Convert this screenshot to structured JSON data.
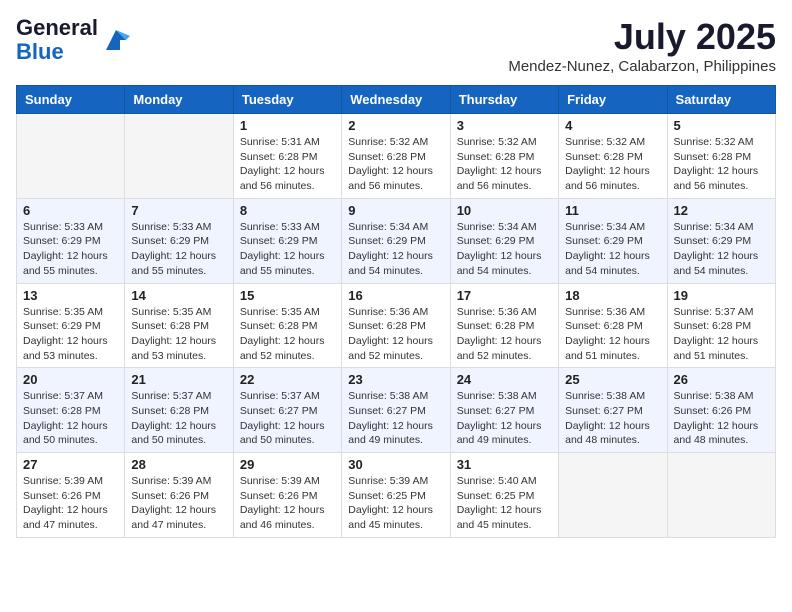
{
  "header": {
    "logo_general": "General",
    "logo_blue": "Blue",
    "month_title": "July 2025",
    "location": "Mendez-Nunez, Calabarzon, Philippines"
  },
  "days_of_week": [
    "Sunday",
    "Monday",
    "Tuesday",
    "Wednesday",
    "Thursday",
    "Friday",
    "Saturday"
  ],
  "weeks": [
    [
      {
        "day": "",
        "info": ""
      },
      {
        "day": "",
        "info": ""
      },
      {
        "day": "1",
        "info": "Sunrise: 5:31 AM\nSunset: 6:28 PM\nDaylight: 12 hours and 56 minutes."
      },
      {
        "day": "2",
        "info": "Sunrise: 5:32 AM\nSunset: 6:28 PM\nDaylight: 12 hours and 56 minutes."
      },
      {
        "day": "3",
        "info": "Sunrise: 5:32 AM\nSunset: 6:28 PM\nDaylight: 12 hours and 56 minutes."
      },
      {
        "day": "4",
        "info": "Sunrise: 5:32 AM\nSunset: 6:28 PM\nDaylight: 12 hours and 56 minutes."
      },
      {
        "day": "5",
        "info": "Sunrise: 5:32 AM\nSunset: 6:28 PM\nDaylight: 12 hours and 56 minutes."
      }
    ],
    [
      {
        "day": "6",
        "info": "Sunrise: 5:33 AM\nSunset: 6:29 PM\nDaylight: 12 hours and 55 minutes."
      },
      {
        "day": "7",
        "info": "Sunrise: 5:33 AM\nSunset: 6:29 PM\nDaylight: 12 hours and 55 minutes."
      },
      {
        "day": "8",
        "info": "Sunrise: 5:33 AM\nSunset: 6:29 PM\nDaylight: 12 hours and 55 minutes."
      },
      {
        "day": "9",
        "info": "Sunrise: 5:34 AM\nSunset: 6:29 PM\nDaylight: 12 hours and 54 minutes."
      },
      {
        "day": "10",
        "info": "Sunrise: 5:34 AM\nSunset: 6:29 PM\nDaylight: 12 hours and 54 minutes."
      },
      {
        "day": "11",
        "info": "Sunrise: 5:34 AM\nSunset: 6:29 PM\nDaylight: 12 hours and 54 minutes."
      },
      {
        "day": "12",
        "info": "Sunrise: 5:34 AM\nSunset: 6:29 PM\nDaylight: 12 hours and 54 minutes."
      }
    ],
    [
      {
        "day": "13",
        "info": "Sunrise: 5:35 AM\nSunset: 6:29 PM\nDaylight: 12 hours and 53 minutes."
      },
      {
        "day": "14",
        "info": "Sunrise: 5:35 AM\nSunset: 6:28 PM\nDaylight: 12 hours and 53 minutes."
      },
      {
        "day": "15",
        "info": "Sunrise: 5:35 AM\nSunset: 6:28 PM\nDaylight: 12 hours and 52 minutes."
      },
      {
        "day": "16",
        "info": "Sunrise: 5:36 AM\nSunset: 6:28 PM\nDaylight: 12 hours and 52 minutes."
      },
      {
        "day": "17",
        "info": "Sunrise: 5:36 AM\nSunset: 6:28 PM\nDaylight: 12 hours and 52 minutes."
      },
      {
        "day": "18",
        "info": "Sunrise: 5:36 AM\nSunset: 6:28 PM\nDaylight: 12 hours and 51 minutes."
      },
      {
        "day": "19",
        "info": "Sunrise: 5:37 AM\nSunset: 6:28 PM\nDaylight: 12 hours and 51 minutes."
      }
    ],
    [
      {
        "day": "20",
        "info": "Sunrise: 5:37 AM\nSunset: 6:28 PM\nDaylight: 12 hours and 50 minutes."
      },
      {
        "day": "21",
        "info": "Sunrise: 5:37 AM\nSunset: 6:28 PM\nDaylight: 12 hours and 50 minutes."
      },
      {
        "day": "22",
        "info": "Sunrise: 5:37 AM\nSunset: 6:27 PM\nDaylight: 12 hours and 50 minutes."
      },
      {
        "day": "23",
        "info": "Sunrise: 5:38 AM\nSunset: 6:27 PM\nDaylight: 12 hours and 49 minutes."
      },
      {
        "day": "24",
        "info": "Sunrise: 5:38 AM\nSunset: 6:27 PM\nDaylight: 12 hours and 49 minutes."
      },
      {
        "day": "25",
        "info": "Sunrise: 5:38 AM\nSunset: 6:27 PM\nDaylight: 12 hours and 48 minutes."
      },
      {
        "day": "26",
        "info": "Sunrise: 5:38 AM\nSunset: 6:26 PM\nDaylight: 12 hours and 48 minutes."
      }
    ],
    [
      {
        "day": "27",
        "info": "Sunrise: 5:39 AM\nSunset: 6:26 PM\nDaylight: 12 hours and 47 minutes."
      },
      {
        "day": "28",
        "info": "Sunrise: 5:39 AM\nSunset: 6:26 PM\nDaylight: 12 hours and 47 minutes."
      },
      {
        "day": "29",
        "info": "Sunrise: 5:39 AM\nSunset: 6:26 PM\nDaylight: 12 hours and 46 minutes."
      },
      {
        "day": "30",
        "info": "Sunrise: 5:39 AM\nSunset: 6:25 PM\nDaylight: 12 hours and 45 minutes."
      },
      {
        "day": "31",
        "info": "Sunrise: 5:40 AM\nSunset: 6:25 PM\nDaylight: 12 hours and 45 minutes."
      },
      {
        "day": "",
        "info": ""
      },
      {
        "day": "",
        "info": ""
      }
    ]
  ]
}
